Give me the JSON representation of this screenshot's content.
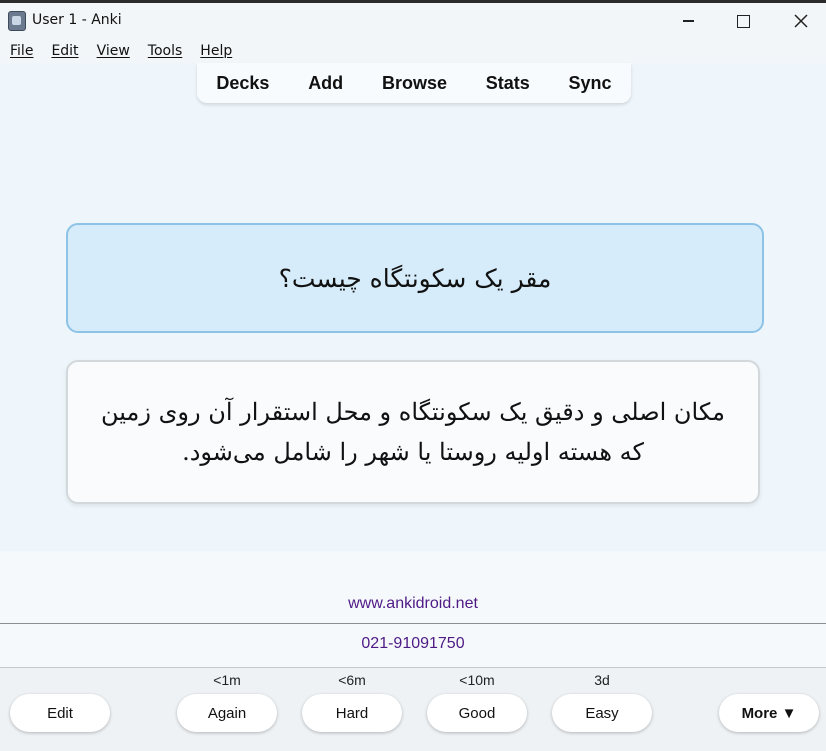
{
  "window": {
    "title": "User 1 - Anki"
  },
  "menu": [
    "File",
    "Edit",
    "View",
    "Tools",
    "Help"
  ],
  "toolbar": {
    "decks": "Decks",
    "add": "Add",
    "browse": "Browse",
    "stats": "Stats",
    "sync": "Sync"
  },
  "card": {
    "question": "مقر یک سکونتگاه چیست؟",
    "answer": "مکان اصلی و دقیق یک سکونتگاه و محل استقرار آن روی زمین که هسته اولیه روستا یا شهر را شامل می‌شود."
  },
  "footer": {
    "website": "www.ankidroid.net",
    "phone": "021-91091750"
  },
  "answer_bar": {
    "edit": "Edit",
    "again": {
      "label": "Again",
      "interval": "<1m"
    },
    "hard": {
      "label": "Hard",
      "interval": "<6m"
    },
    "good": {
      "label": "Good",
      "interval": "<10m"
    },
    "easy": {
      "label": "Easy",
      "interval": "3d"
    },
    "more": "More ▼"
  },
  "icons": [
    "anki-app-icon",
    "minimize-icon",
    "maximize-icon",
    "close-icon"
  ]
}
